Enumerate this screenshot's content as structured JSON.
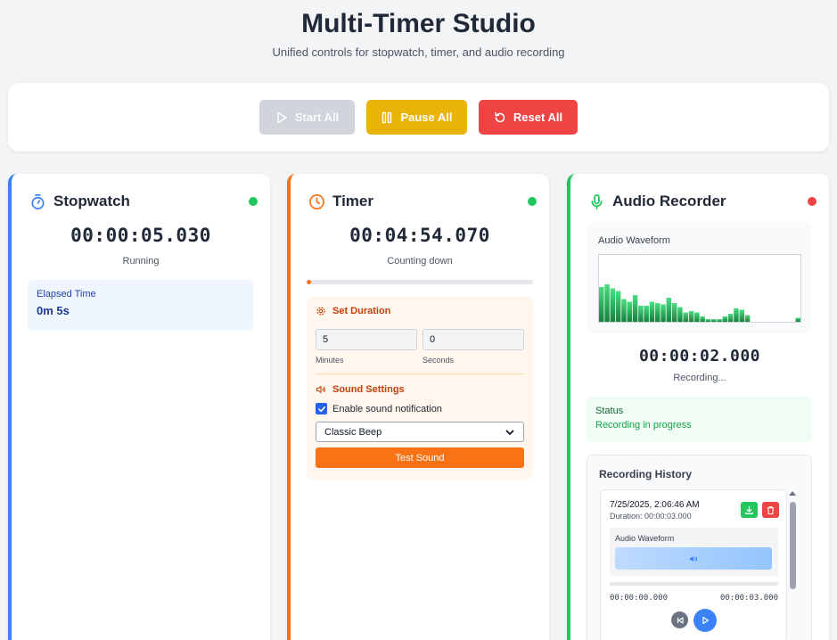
{
  "header": {
    "title": "Multi-Timer Studio",
    "subtitle": "Unified controls for stopwatch, timer, and audio recording"
  },
  "controls": {
    "start_all": "Start All",
    "pause_all": "Pause All",
    "reset_all": "Reset All"
  },
  "stopwatch": {
    "title": "Stopwatch",
    "time": "00:00:05.030",
    "status": "Running",
    "elapsed_label": "Elapsed Time",
    "elapsed_value": "0m 5s",
    "indicator_color": "#22c55e"
  },
  "timer": {
    "title": "Timer",
    "time": "00:04:54.070",
    "status": "Counting down",
    "progress": 0.02,
    "set_duration_title": "Set Duration",
    "minutes_value": "5",
    "seconds_value": "0",
    "minutes_label": "Minutes",
    "seconds_label": "Seconds",
    "sound_settings_title": "Sound Settings",
    "enable_sound_label": "Enable sound notification",
    "enable_sound_checked": true,
    "sound_option": "Classic Beep",
    "test_sound_label": "Test Sound",
    "indicator_color": "#22c55e"
  },
  "recorder": {
    "title": "Audio Recorder",
    "waveform_label": "Audio Waveform",
    "waveform_levels": [
      0.52,
      0.56,
      0.5,
      0.46,
      0.34,
      0.3,
      0.4,
      0.24,
      0.24,
      0.3,
      0.28,
      0.26,
      0.36,
      0.28,
      0.22,
      0.14,
      0.16,
      0.14,
      0.08,
      0.04,
      0.04,
      0.04,
      0.08,
      0.12,
      0.2,
      0.18,
      0.1,
      0,
      0,
      0,
      0,
      0,
      0,
      0,
      0,
      0.06
    ],
    "time": "00:00:02.000",
    "status": "Recording...",
    "status_label": "Status",
    "status_value": "Recording in progress",
    "indicator_color": "#ef4444",
    "history": {
      "title": "Recording History",
      "items": [
        {
          "date": "7/25/2025, 2:06:46 AM",
          "duration": "Duration: 00:00:03.000",
          "waveform_label": "Audio Waveform",
          "current_time": "00:00:00.000",
          "total_time": "00:00:03.000"
        }
      ]
    }
  }
}
